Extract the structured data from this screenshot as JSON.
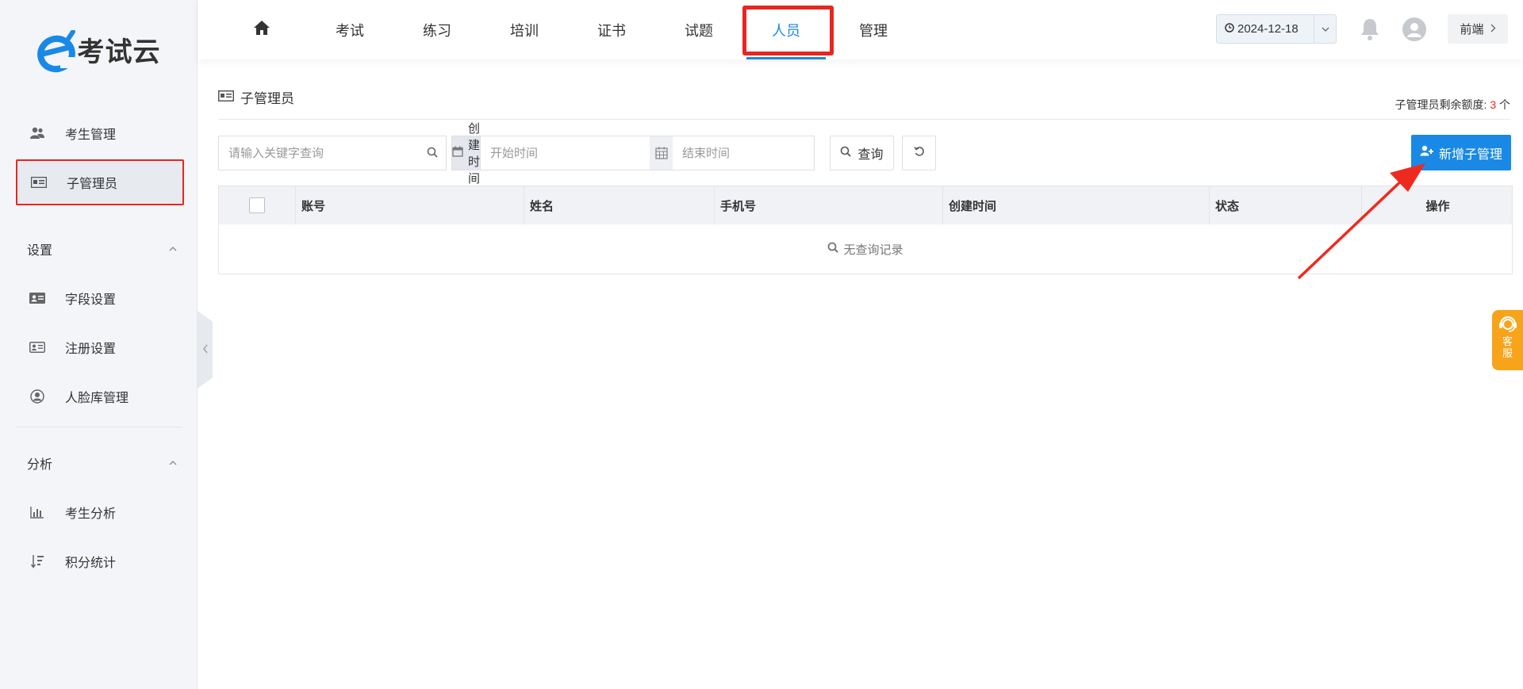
{
  "brand": {
    "name": "考试云"
  },
  "sidebar": {
    "items": [
      {
        "label": "考生管理",
        "icon": "users-icon"
      },
      {
        "label": "子管理员",
        "icon": "id-card-icon"
      }
    ],
    "groups": [
      {
        "title": "设置",
        "items": [
          {
            "label": "字段设置",
            "icon": "address-card-icon"
          },
          {
            "label": "注册设置",
            "icon": "id-badge-icon"
          },
          {
            "label": "人脸库管理",
            "icon": "user-circle-icon"
          }
        ]
      },
      {
        "title": "分析",
        "items": [
          {
            "label": "考生分析",
            "icon": "bar-chart-icon"
          },
          {
            "label": "积分统计",
            "icon": "sort-amount-icon"
          }
        ]
      }
    ]
  },
  "topnav": {
    "tabs": [
      {
        "label": "考试"
      },
      {
        "label": "练习"
      },
      {
        "label": "培训"
      },
      {
        "label": "证书"
      },
      {
        "label": "试题"
      },
      {
        "label": "人员"
      },
      {
        "label": "管理"
      }
    ],
    "date": "2024-12-18",
    "front_label": "前端"
  },
  "page": {
    "title": "子管理员",
    "quota_label": "子管理员剩余额度:",
    "quota_count": "3",
    "quota_unit": "个"
  },
  "filters": {
    "search_placeholder": "请输入关键字查询",
    "date_label": "创建时间",
    "start_placeholder": "开始时间",
    "end_placeholder": "结束时间",
    "query_label": "查询",
    "add_label": "新增子管理"
  },
  "table": {
    "columns": [
      "账号",
      "姓名",
      "手机号",
      "创建时间",
      "状态",
      "操作"
    ],
    "empty_text": "无查询记录"
  },
  "service": {
    "label_1": "客",
    "label_2": "服"
  },
  "colors": {
    "accent": "#1a89e6",
    "highlight": "#e8261f",
    "service": "#f7a41b"
  }
}
